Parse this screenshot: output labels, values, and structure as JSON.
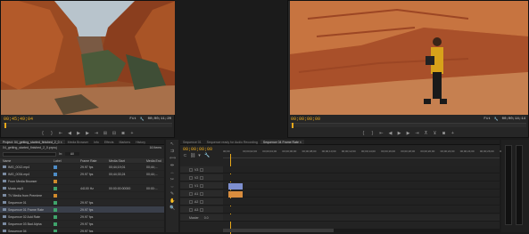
{
  "source_monitor": {
    "timecode_left": "00;45;49;04",
    "zoom": "Fit",
    "timecode_right": "00;00;11;20"
  },
  "program_monitor": {
    "timecode_left": "00;00;00;00",
    "zoom": "Fit",
    "timecode_right": "00;00;14;14"
  },
  "project_panel": {
    "tabs": [
      "Project: 04_getting_started_finished_2_0 ×",
      "Media Browser",
      "Info",
      "Effects",
      "Markers",
      "History"
    ],
    "project_file": "04_getting_started_finished_2_0.prproj",
    "item_count": "16 Items",
    "search_placeholder": "",
    "in_label": "In:",
    "in_value": "All",
    "columns": [
      "Name",
      "Label",
      "Frame Rate",
      "Media Start",
      "Media End"
    ],
    "items": [
      {
        "name": "IMG_0012.mp4",
        "label_color": "#4d8cc6",
        "frame_rate": "29.97 fps",
        "media_start": "00;44;19;01",
        "media_end": "00;44;..."
      },
      {
        "name": "IMG_0034.mp4",
        "label_color": "#4d8cc6",
        "frame_rate": "29.97 fps",
        "media_start": "00;44;33;24",
        "media_end": "00;44;..."
      },
      {
        "name": "From Media Browser",
        "label_color": "#d08a2c",
        "frame_rate": "",
        "media_start": "",
        "media_end": ""
      },
      {
        "name": "Music.mp3",
        "label_color": "#3fa36b",
        "frame_rate": "44100 Hz",
        "media_start": "00:00:00:00000",
        "media_end": "00:00:..."
      },
      {
        "name": "TV Media from Premiere",
        "label_color": "#d08a2c",
        "frame_rate": "",
        "media_start": "",
        "media_end": ""
      },
      {
        "name": "Sequence 01",
        "label_color": "#3fa36b",
        "frame_rate": "29.97 fps",
        "media_start": "",
        "media_end": ""
      },
      {
        "name": "Sequence 01 Frame Rate",
        "label_color": "#3fa36b",
        "frame_rate": "29.97 fps",
        "media_start": "",
        "media_end": ""
      },
      {
        "name": "Sequence 02 Add Rate",
        "label_color": "#3fa36b",
        "frame_rate": "29.97 fps",
        "media_start": "",
        "media_end": ""
      },
      {
        "name": "Sequence 03 Bad Alpha",
        "label_color": "#3fa36b",
        "frame_rate": "29.97 fps",
        "media_start": "",
        "media_end": ""
      },
      {
        "name": "Sequence 04",
        "label_color": "#3fa36b",
        "frame_rate": "29.97 fps",
        "media_start": "",
        "media_end": ""
      },
      {
        "name": "Sequence ready for Audio",
        "label_color": "#3fa36b",
        "frame_rate": "29.97 fps",
        "media_start": "",
        "media_end": ""
      }
    ]
  },
  "timeline": {
    "tabs": [
      "Sequence 01",
      "Sequence ready for Audio Recording",
      "Sequence 04 Frame Rate ×"
    ],
    "timecode": "00;00;00;00",
    "ruler_ticks": [
      "00;00",
      "00;00;02;00",
      "00;00;04;00",
      "00;00;06;00",
      "00;00;08;00",
      "00;00;10;00",
      "00;00;12;00",
      "00;00;14;00",
      "00;00;16;00",
      "00;00;18;00",
      "00;00;20;00",
      "00;00;22;00",
      "00;00;24;00",
      "00;00;26;00",
      "00;00;28;00"
    ],
    "tracks": [
      "V3",
      "V2",
      "V1",
      "A1",
      "A2",
      "A3"
    ],
    "master_label": "Master",
    "master_value": "0.0"
  },
  "colors": {
    "timecode": "#e8a81a",
    "video_clip": "#7e8fcf",
    "audio_clip": "#d98d3e",
    "playhead": "#e8a81a"
  }
}
